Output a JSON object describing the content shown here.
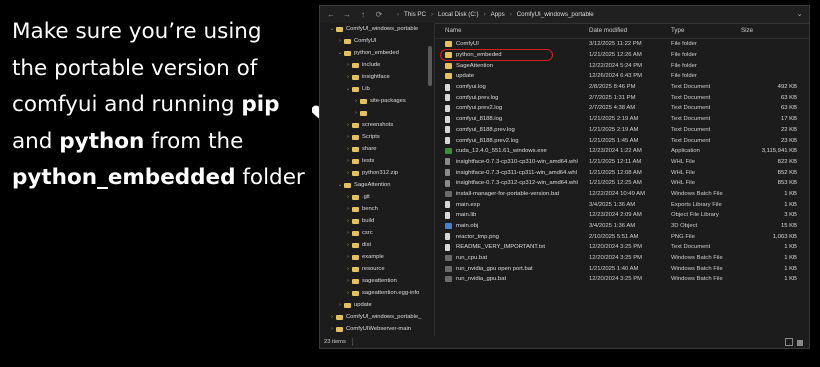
{
  "caption": {
    "line1": "Make sure you’re using",
    "line2": "the portable version of",
    "line3_pre": "comfyui and running ",
    "line3_bold": "pip",
    "line4_pre": "and ",
    "line4_bold": "python",
    "line4_post": " from the",
    "line5_bold": "python_embedded",
    "line5_post": " folder"
  },
  "address": {
    "back": "←",
    "forward": "→",
    "up": "↑",
    "refresh": "⟳",
    "crumbs": [
      "This PC",
      "Local Disk (C:)",
      "Apps",
      "ComfyUI_windows_portable"
    ],
    "end": "⌄"
  },
  "tree": [
    {
      "label": "ComfyUI_windows_portable",
      "indent": 1,
      "open": true
    },
    {
      "label": "ComfyUI",
      "indent": 2,
      "open": false
    },
    {
      "label": "python_embeded",
      "indent": 2,
      "open": true
    },
    {
      "label": "include",
      "indent": 3,
      "open": false
    },
    {
      "label": "insightface",
      "indent": 3,
      "open": false
    },
    {
      "label": "Lib",
      "indent": 3,
      "open": true
    },
    {
      "label": "site-packages",
      "indent": 4,
      "open": false
    },
    {
      "label": "",
      "indent": 4,
      "open": false
    },
    {
      "label": "screenshots",
      "indent": 3,
      "open": false
    },
    {
      "label": "Scripts",
      "indent": 3,
      "open": false
    },
    {
      "label": "share",
      "indent": 3,
      "open": false
    },
    {
      "label": "tests",
      "indent": 3,
      "open": false
    },
    {
      "label": "python312.zip",
      "indent": 3,
      "open": false
    },
    {
      "label": "SageAttention",
      "indent": 2,
      "open": true
    },
    {
      "label": ".git",
      "indent": 3,
      "open": false
    },
    {
      "label": "bench",
      "indent": 3,
      "open": false
    },
    {
      "label": "build",
      "indent": 3,
      "open": false
    },
    {
      "label": "csrc",
      "indent": 3,
      "open": false
    },
    {
      "label": "dist",
      "indent": 3,
      "open": false
    },
    {
      "label": "example",
      "indent": 3,
      "open": false
    },
    {
      "label": "resource",
      "indent": 3,
      "open": false
    },
    {
      "label": "sageattention",
      "indent": 3,
      "open": false
    },
    {
      "label": "sageattention.egg-info",
      "indent": 3,
      "open": false
    },
    {
      "label": "update",
      "indent": 2,
      "open": false
    },
    {
      "label": "ComfyUI_windows_portable_",
      "indent": 1,
      "open": false
    },
    {
      "label": "ComfyUIWebserver-main",
      "indent": 1,
      "open": false
    }
  ],
  "columns": {
    "name": "Name",
    "date": "Date modified",
    "type": "Type",
    "size": "Size"
  },
  "files": [
    {
      "name": "ComfyUI",
      "date": "3/12/2025 11:22 PM",
      "type": "File folder",
      "size": "",
      "icon": "folder"
    },
    {
      "name": "python_embeded",
      "date": "1/21/2025 12:26 AM",
      "type": "File folder",
      "size": "",
      "icon": "folder"
    },
    {
      "name": "SageAttention",
      "date": "12/22/2024 5:24 PM",
      "type": "File folder",
      "size": "",
      "icon": "folder"
    },
    {
      "name": "update",
      "date": "12/26/2024 6:43 PM",
      "type": "File folder",
      "size": "",
      "icon": "folder"
    },
    {
      "name": "comfyui.log",
      "date": "2/8/2025 8:46 PM",
      "type": "Text Document",
      "size": "492 KB",
      "icon": "file"
    },
    {
      "name": "comfyui.prev.log",
      "date": "2/7/2025 1:31 PM",
      "type": "Text Document",
      "size": "63 KB",
      "icon": "file"
    },
    {
      "name": "comfyui.prev2.log",
      "date": "2/7/2025 4:38 AM",
      "type": "Text Document",
      "size": "63 KB",
      "icon": "file"
    },
    {
      "name": "comfyui_8188.log",
      "date": "1/21/2025 2:19 AM",
      "type": "Text Document",
      "size": "17 KB",
      "icon": "file"
    },
    {
      "name": "comfyui_8188.prev.log",
      "date": "1/21/2025 2:19 AM",
      "type": "Text Document",
      "size": "22 KB",
      "icon": "file"
    },
    {
      "name": "comfyui_8188.prev2.log",
      "date": "1/21/2025 1:45 AM",
      "type": "Text Document",
      "size": "23 KB",
      "icon": "file"
    },
    {
      "name": "cuda_12.4.0_551.61_windows.exe",
      "date": "12/23/2024 1:22 AM",
      "type": "Application",
      "size": "3,115,941 KB",
      "icon": "app"
    },
    {
      "name": "insightface-0.7.3-cp310-cp310-win_amd64.whl",
      "date": "1/21/2025 12:11 AM",
      "type": "WHL File",
      "size": "822 KB",
      "icon": "whl"
    },
    {
      "name": "insightface-0.7.3-cp311-cp311-win_amd64.whl",
      "date": "1/21/2025 12:08 AM",
      "type": "WHL File",
      "size": "852 KB",
      "icon": "whl"
    },
    {
      "name": "insightface-0.7.3-cp312-cp312-win_amd64.whl",
      "date": "1/21/2025 12:25 AM",
      "type": "WHL File",
      "size": "853 KB",
      "icon": "whl"
    },
    {
      "name": "install-manager-for-portable-version.bat",
      "date": "12/22/2024 10:49 AM",
      "type": "Windows Batch File",
      "size": "1 KB",
      "icon": "bat"
    },
    {
      "name": "main.exp",
      "date": "3/4/2025 1:36 AM",
      "type": "Exports Library File",
      "size": "1 KB",
      "icon": "file"
    },
    {
      "name": "main.lib",
      "date": "12/23/2024 2:09 AM",
      "type": "Object File Library",
      "size": "3 KB",
      "icon": "file"
    },
    {
      "name": "main.obj",
      "date": "3/4/2025 1:36 AM",
      "type": "3D Object",
      "size": "15 KB",
      "icon": "exe3"
    },
    {
      "name": "reactor_tmp.png",
      "date": "2/10/2025 5:51 AM",
      "type": "PNG File",
      "size": "1,063 KB",
      "icon": "file"
    },
    {
      "name": "README_VERY_IMPORTANT.txt",
      "date": "12/20/2024 3:25 PM",
      "type": "Text Document",
      "size": "1 KB",
      "icon": "file"
    },
    {
      "name": "run_cpu.bat",
      "date": "12/20/2024 3:25 PM",
      "type": "Windows Batch File",
      "size": "1 KB",
      "icon": "bat"
    },
    {
      "name": "run_nvidia_gpu open port.bat",
      "date": "1/21/2025 1:40 AM",
      "type": "Windows Batch File",
      "size": "1 KB",
      "icon": "bat"
    },
    {
      "name": "run_nvidia_gpu.bat",
      "date": "12/20/2024 3:25 PM",
      "type": "Windows Batch File",
      "size": "1 KB",
      "icon": "bat"
    }
  ],
  "status": {
    "count": "23 items"
  },
  "colors": {
    "highlight": "#d02020",
    "folder": "#e6c15a"
  }
}
